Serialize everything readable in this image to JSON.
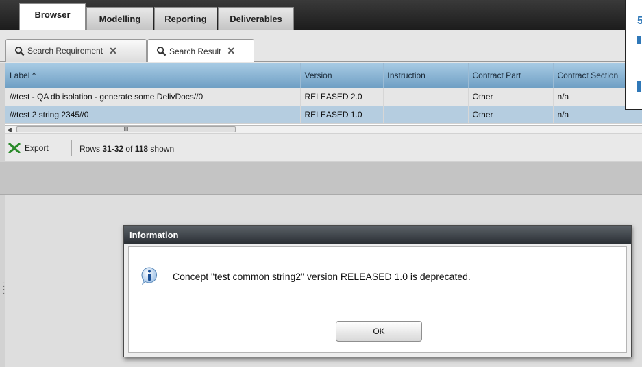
{
  "nav": {
    "tabs": [
      "Browser",
      "Modelling",
      "Reporting",
      "Deliverables"
    ],
    "active": "Browser"
  },
  "subtabs": [
    {
      "label": "Search Requirement",
      "active": false
    },
    {
      "label": "Search Result",
      "active": true
    }
  ],
  "grid": {
    "columns": [
      "Label ^",
      "Version",
      "Instruction",
      "Contract Part",
      "Contract Section"
    ],
    "rows": [
      [
        "///test - QA db isolation - generate some DelivDocs//0",
        "RELEASED 2.0",
        "",
        "Other",
        "n/a"
      ],
      [
        "///test 2 string 2345//0",
        "RELEASED 1.0",
        "",
        "Other",
        "n/a"
      ]
    ],
    "scroll_thumb_glyph": "III",
    "selected_row": 1
  },
  "toolbar": {
    "export_label": "Export",
    "rows_prefix": "Rows ",
    "rows_range": "31-32",
    "rows_of": " of ",
    "rows_total": "118",
    "rows_suffix": " shown"
  },
  "dialog": {
    "title": "Information",
    "message": "Concept \"test common string2\" version RELEASED 1.0 is deprecated.",
    "ok_label": "OK"
  },
  "callout": {
    "glyph": "5"
  },
  "colors": {
    "header_blue": "#8db7d6",
    "selected_row": "#b5cde0",
    "accent": "#2f78b8"
  }
}
